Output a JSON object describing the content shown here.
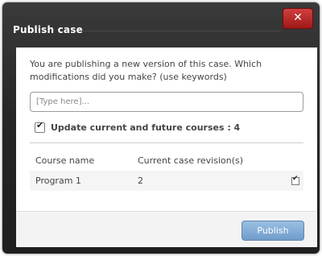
{
  "dialog": {
    "title": "Publish case",
    "close_label": "✕",
    "prompt": "You are publishing a new version of this case. Which modifications did you make? (use keywords)",
    "input": {
      "placeholder": "[Type here]...",
      "value": ""
    },
    "update_checkbox": {
      "checked": true,
      "label": "Update current and future courses : 4"
    },
    "table": {
      "headers": [
        "Course name",
        "Current case revision(s)"
      ],
      "rows": [
        {
          "course": "Program 1",
          "revision": "2",
          "checked": true
        }
      ]
    },
    "publish_label": "Publish"
  },
  "colors": {
    "close_button": "#b82020",
    "publish_button": "#7fa8d5",
    "dialog_frame": "#2a2a2a"
  }
}
